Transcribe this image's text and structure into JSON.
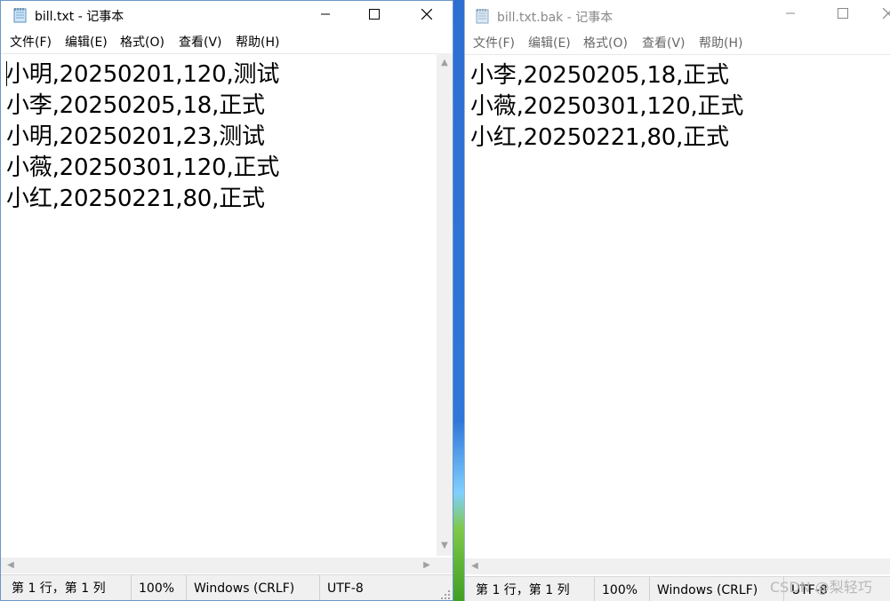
{
  "window1": {
    "title": "bill.txt - 记事本",
    "menu": [
      "文件(F)",
      "编辑(E)",
      "格式(O)",
      "查看(V)",
      "帮助(H)"
    ],
    "lines": [
      "小明,20250201,120,测试",
      "小李,20250205,18,正式",
      "小明,20250201,23,测试",
      "小薇,20250301,120,正式",
      "小红,20250221,80,正式"
    ],
    "status": {
      "position": "第 1 行，第 1 列",
      "zoom": "100%",
      "line_ending": "Windows (CRLF)",
      "encoding": "UTF-8"
    }
  },
  "window2": {
    "title": "bill.txt.bak - 记事本",
    "menu": [
      "文件(F)",
      "编辑(E)",
      "格式(O)",
      "查看(V)",
      "帮助(H)"
    ],
    "lines": [
      "小李,20250205,18,正式",
      "小薇,20250301,120,正式",
      "小红,20250221,80,正式"
    ],
    "status": {
      "position": "第 1 行，第 1 列",
      "zoom": "100%",
      "line_ending": "Windows (CRLF)",
      "encoding": "UTF-8"
    }
  },
  "watermark": "CSDN @梨轻巧",
  "icons": {
    "app": "notepad-icon",
    "minimize": "minimize-icon",
    "maximize": "maximize-icon",
    "close": "close-icon"
  },
  "colors": {
    "desktop_blue": "#2f77d8",
    "desktop_green": "#3f9f22",
    "window_border": "#6a96c8",
    "statusbar_bg": "#f0f0f0"
  }
}
